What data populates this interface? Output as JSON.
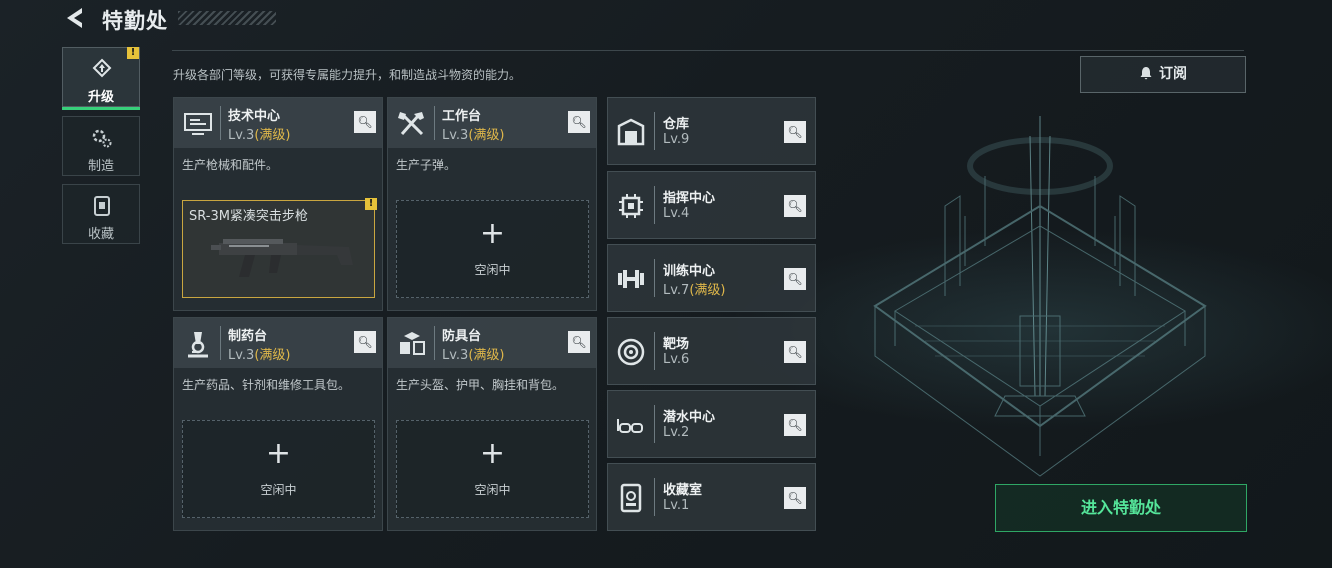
{
  "header": {
    "title": "特勤处"
  },
  "nav": [
    {
      "label": "升级",
      "icon": "upgrade-icon",
      "active": true,
      "badge": "!"
    },
    {
      "label": "制造",
      "icon": "gears-icon",
      "active": false
    },
    {
      "label": "收藏",
      "icon": "collection-icon",
      "active": false
    }
  ],
  "description": "升级各部门等级，可获得专属能力提升，和制造战斗物资的能力。",
  "subscribe_label": "订阅",
  "departments": [
    {
      "name": "技术中心",
      "level": "Lv.3",
      "max": "(满级)",
      "desc": "生产枪械和配件。",
      "icon": "tech-terminal-icon",
      "slot": {
        "item": "SR-3M紧凑突击步枪",
        "badge": "!"
      }
    },
    {
      "name": "工作台",
      "level": "Lv.3",
      "max": "(满级)",
      "desc": "生产子弹。",
      "icon": "tools-icon",
      "slot": {
        "plus": "+",
        "status": "空闲中"
      }
    },
    {
      "name": "制药台",
      "level": "Lv.3",
      "max": "(满级)",
      "desc": "生产药品、针剂和维修工具包。",
      "icon": "microscope-icon",
      "slot": {
        "plus": "+",
        "status": "空闲中"
      }
    },
    {
      "name": "防具台",
      "level": "Lv.3",
      "max": "(满级)",
      "desc": "生产头盔、护甲、胸挂和背包。",
      "icon": "armor-blocks-icon",
      "slot": {
        "plus": "+",
        "status": "空闲中"
      }
    }
  ],
  "facilities": [
    {
      "name": "仓库",
      "level": "Lv.9",
      "icon": "warehouse-icon"
    },
    {
      "name": "指挥中心",
      "level": "Lv.4",
      "icon": "chip-icon"
    },
    {
      "name": "训练中心",
      "level": "Lv.7",
      "max": "(满级)",
      "icon": "dumbbell-icon"
    },
    {
      "name": "靶场",
      "level": "Lv.6",
      "icon": "target-icon"
    },
    {
      "name": "潜水中心",
      "level": "Lv.2",
      "icon": "diving-goggles-icon"
    },
    {
      "name": "收藏室",
      "level": "Lv.1",
      "icon": "collection-room-icon"
    }
  ],
  "enter_label": "进入特勤处",
  "colors": {
    "accent_green": "#37d07a",
    "max_level": "#e0b84a",
    "badge": "#e6c23a"
  }
}
